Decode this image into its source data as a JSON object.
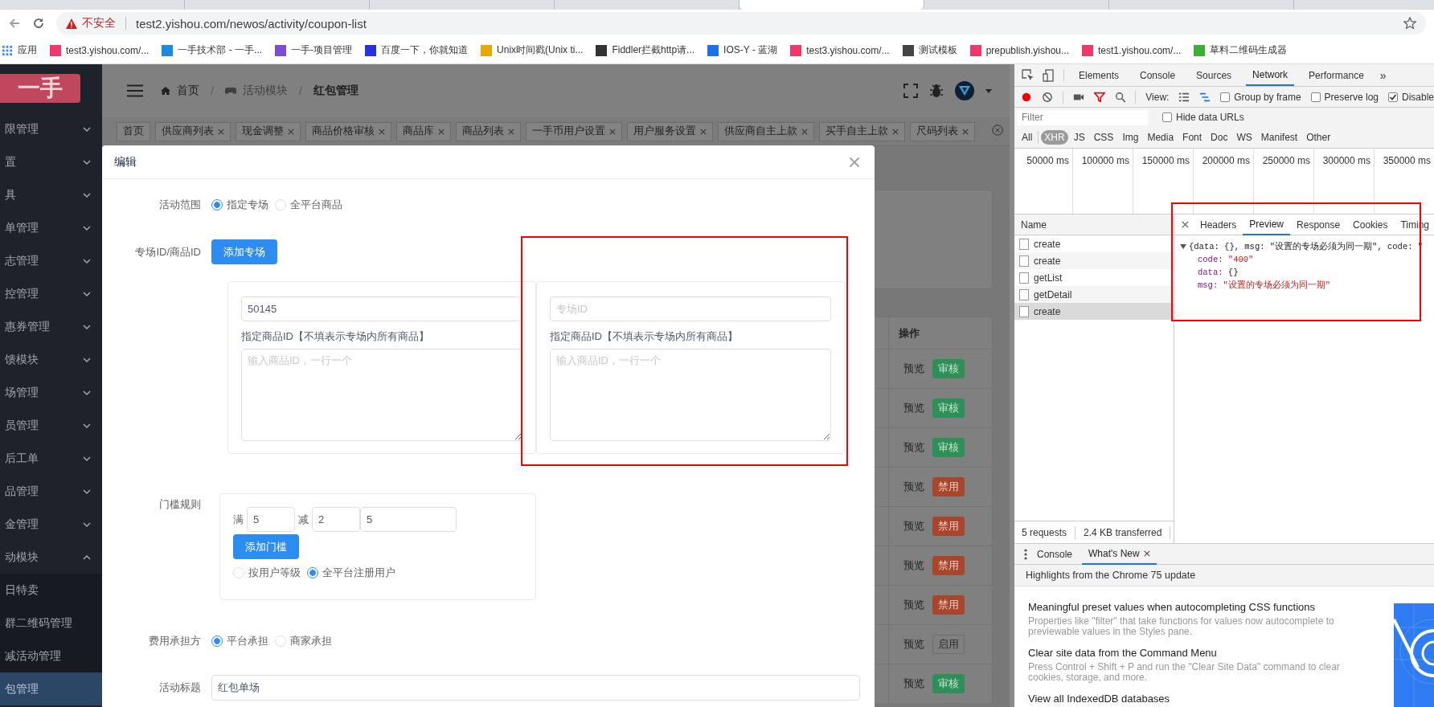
{
  "browser": {
    "tabs": [
      {
        "selected": false
      },
      {
        "selected": false
      },
      {
        "selected": false
      },
      {
        "selected": false
      },
      {
        "selected": true
      },
      {
        "selected": false
      },
      {
        "selected": false
      }
    ],
    "address": {
      "security": "不安全",
      "url": "test2.yishou.com/newos/activity/coupon-list"
    },
    "bookmarks": [
      {
        "label": "应用",
        "kind": "apps"
      },
      {
        "label": "test3.yishou.com/...",
        "kind": "favicon",
        "color": "#f0386b"
      },
      {
        "label": "一手技术部 - 一手...",
        "kind": "favicon",
        "color": "#1e88e5"
      },
      {
        "label": "一手-项目管理",
        "kind": "favicon",
        "color": "#7b4dd6"
      },
      {
        "label": "百度一下，你就知道",
        "kind": "favicon",
        "color": "#2932e1"
      },
      {
        "label": "Unix时间戳(Unix ti...",
        "kind": "favicon",
        "color": "#e8a800"
      },
      {
        "label": "Fiddler拦截http请...",
        "kind": "favicon",
        "color": "#333333"
      },
      {
        "label": "IOS-Y - 蓝湖",
        "kind": "favicon",
        "color": "#1a73e8"
      },
      {
        "label": "test3.yishou.com/...",
        "kind": "favicon",
        "color": "#f0386b"
      },
      {
        "label": "测试模板",
        "kind": "favicon",
        "color": "#444444"
      },
      {
        "label": "prepublish.yishou...",
        "kind": "favicon",
        "color": "#f0386b"
      },
      {
        "label": "test1.yishou.com/...",
        "kind": "favicon",
        "color": "#f0386b"
      },
      {
        "label": "草料二维码生成器",
        "kind": "favicon",
        "color": "#3cb034"
      }
    ]
  },
  "sidebar": {
    "logo": "一手",
    "items": [
      {
        "label": "限管理",
        "expanded": false
      },
      {
        "label": "置",
        "expanded": false
      },
      {
        "label": "具",
        "expanded": false
      },
      {
        "label": "单管理",
        "expanded": false
      },
      {
        "label": "志管理",
        "expanded": false
      },
      {
        "label": "控管理",
        "expanded": false
      },
      {
        "label": "惠券管理",
        "expanded": false
      },
      {
        "label": "馈模块",
        "expanded": false
      },
      {
        "label": "场管理",
        "expanded": false
      },
      {
        "label": "员管理",
        "expanded": false
      },
      {
        "label": "后工单",
        "expanded": false
      },
      {
        "label": "品管理",
        "expanded": false
      },
      {
        "label": "金管理",
        "expanded": false
      },
      {
        "label": "动模块",
        "expanded": true,
        "children": [
          {
            "label": "日特卖",
            "selected": false
          },
          {
            "label": "群二维码管理",
            "selected": false
          },
          {
            "label": "减活动管理",
            "selected": false
          },
          {
            "label": "包管理",
            "selected": true
          }
        ]
      }
    ]
  },
  "header": {
    "breadcrumb": [
      {
        "kind": "home",
        "label": "首页"
      },
      {
        "kind": "separator",
        "label": "/"
      },
      {
        "kind": "module",
        "label": "活动模块"
      },
      {
        "kind": "separator",
        "label": "/"
      },
      {
        "kind": "current",
        "label": "红包管理"
      }
    ]
  },
  "page_tabs": [
    {
      "label": "首页",
      "closable": false
    },
    {
      "label": "供应商列表",
      "closable": true
    },
    {
      "label": "现金调整",
      "closable": true
    },
    {
      "label": "商品价格审核",
      "closable": true
    },
    {
      "label": "商品库",
      "closable": true
    },
    {
      "label": "商品列表",
      "closable": true
    },
    {
      "label": "一手币用户设置",
      "closable": true
    },
    {
      "label": "用户服务设置",
      "closable": true
    },
    {
      "label": "供应商自主上款",
      "closable": true
    },
    {
      "label": "买手自主上款",
      "closable": true
    },
    {
      "label": "尺码列表",
      "closable": true
    }
  ],
  "table": {
    "columns": [
      "操作"
    ],
    "rows": [
      {
        "preview": "预览",
        "action": "审核",
        "kind": "approve"
      },
      {
        "preview": "预览",
        "action": "审核",
        "kind": "approve"
      },
      {
        "preview": "预览",
        "action": "审核",
        "kind": "approve"
      },
      {
        "preview": "预览",
        "action": "禁用",
        "kind": "disable"
      },
      {
        "preview": "预览",
        "action": "禁用",
        "kind": "disable"
      },
      {
        "preview": "预览",
        "action": "禁用",
        "kind": "disable"
      },
      {
        "preview": "预览",
        "action": "禁用",
        "kind": "disable"
      },
      {
        "preview": "预览",
        "action": "启用",
        "kind": "enable"
      },
      {
        "preview": "预览",
        "action": "审核",
        "kind": "approve"
      }
    ]
  },
  "modal": {
    "title": "编辑",
    "scope": {
      "label": "活动范围",
      "options": [
        {
          "label": "指定专场",
          "selected": true
        },
        {
          "label": "全平台商品",
          "selected": false
        }
      ]
    },
    "sessions": {
      "label": "专场ID/商品ID",
      "add_button": "添加专场",
      "highlighted": true,
      "cards": [
        {
          "value": "50145",
          "goods_label": "指定商品ID【不填表示专场内所有商品】",
          "goods_placeholder": "输入商品ID，一行一个"
        },
        {
          "placeholder": "专场ID",
          "goods_label": "指定商品ID【不填表示专场内所有商品】",
          "goods_placeholder": "输入商品ID，一行一个"
        }
      ]
    },
    "threshold": {
      "label": "门槛规则",
      "full_label": "满",
      "full_value": "5",
      "minus_label": "减",
      "minus_value": "2",
      "extra_value": "5",
      "add_button": "添加门槛",
      "options": [
        {
          "label": "按用户等级",
          "selected": false
        },
        {
          "label": "全平台注册用户",
          "selected": true
        }
      ]
    },
    "cost": {
      "label": "费用承担方",
      "options": [
        {
          "label": "平台承担",
          "selected": true
        },
        {
          "label": "商家承担",
          "selected": false
        }
      ]
    },
    "title_field": {
      "label": "活动标题",
      "value": "红包单场"
    }
  },
  "devtools": {
    "panels": [
      {
        "label": "Elements",
        "selected": false
      },
      {
        "label": "Console",
        "selected": false
      },
      {
        "label": "Sources",
        "selected": false
      },
      {
        "label": "Network",
        "selected": true
      },
      {
        "label": "Performance",
        "selected": false
      }
    ],
    "more": "»",
    "view_label": "View:",
    "options": [
      {
        "label": "Group by frame",
        "checked": false
      },
      {
        "label": "Preserve log",
        "checked": false
      },
      {
        "label": "Disable",
        "checked": true
      }
    ],
    "filter": {
      "placeholder": "Filter",
      "hide_data_urls": {
        "label": "Hide data URLs",
        "checked": false
      }
    },
    "types": [
      {
        "label": "All",
        "selected": false
      },
      {
        "label": "XHR",
        "selected": true
      },
      {
        "label": "JS",
        "selected": false
      },
      {
        "label": "CSS",
        "selected": false
      },
      {
        "label": "Img",
        "selected": false
      },
      {
        "label": "Media",
        "selected": false
      },
      {
        "label": "Font",
        "selected": false
      },
      {
        "label": "Doc",
        "selected": false
      },
      {
        "label": "WS",
        "selected": false
      },
      {
        "label": "Manifest",
        "selected": false
      },
      {
        "label": "Other",
        "selected": false
      }
    ],
    "timeline": [
      "50000 ms",
      "100000 ms",
      "150000 ms",
      "200000 ms",
      "250000 ms",
      "300000 ms",
      "350000 ms"
    ],
    "requests": {
      "header": "Name",
      "rows": [
        {
          "name": "create",
          "selected": false
        },
        {
          "name": "create",
          "selected": false
        },
        {
          "name": "getList",
          "selected": false
        },
        {
          "name": "getDetail",
          "selected": false
        },
        {
          "name": "create",
          "selected": true
        }
      ]
    },
    "detail_tabs": [
      {
        "label": "Headers",
        "selected": false
      },
      {
        "label": "Preview",
        "selected": true
      },
      {
        "label": "Response",
        "selected": false
      },
      {
        "label": "Cookies",
        "selected": false
      },
      {
        "label": "Timing",
        "selected": false
      }
    ],
    "preview": {
      "highlighted": true,
      "expanded": true,
      "summary": "{data: {}, msg: \"设置的专场必须为同一期\", code: \"",
      "props": [
        {
          "key": "code:",
          "value": "\"400\"",
          "kind": "string"
        },
        {
          "key": "data:",
          "value": "{}",
          "kind": "object"
        },
        {
          "key": "msg:",
          "value": "\"设置的专场必须为同一期\"",
          "kind": "string"
        }
      ]
    },
    "status": [
      "5 requests",
      "2.4 KB transferred"
    ],
    "drawer": {
      "tabs": [
        {
          "label": "Console",
          "selected": false,
          "closable": false
        },
        {
          "label": "What's New",
          "selected": true,
          "closable": true
        }
      ],
      "banner": "Highlights from the Chrome 75 update",
      "items": [
        {
          "title": "Meaningful preset values when autocompleting CSS functions",
          "body": "Properties like \"filter\" that take functions for values now autocomplete to previewable values in the Styles pane."
        },
        {
          "title": "Clear site data from the Command Menu",
          "body": "Press Control + Shift + P and run the \"Clear Site Data\" command to clear cookies, storage, and more."
        },
        {
          "title": "View all IndexedDB databases"
        }
      ]
    }
  }
}
